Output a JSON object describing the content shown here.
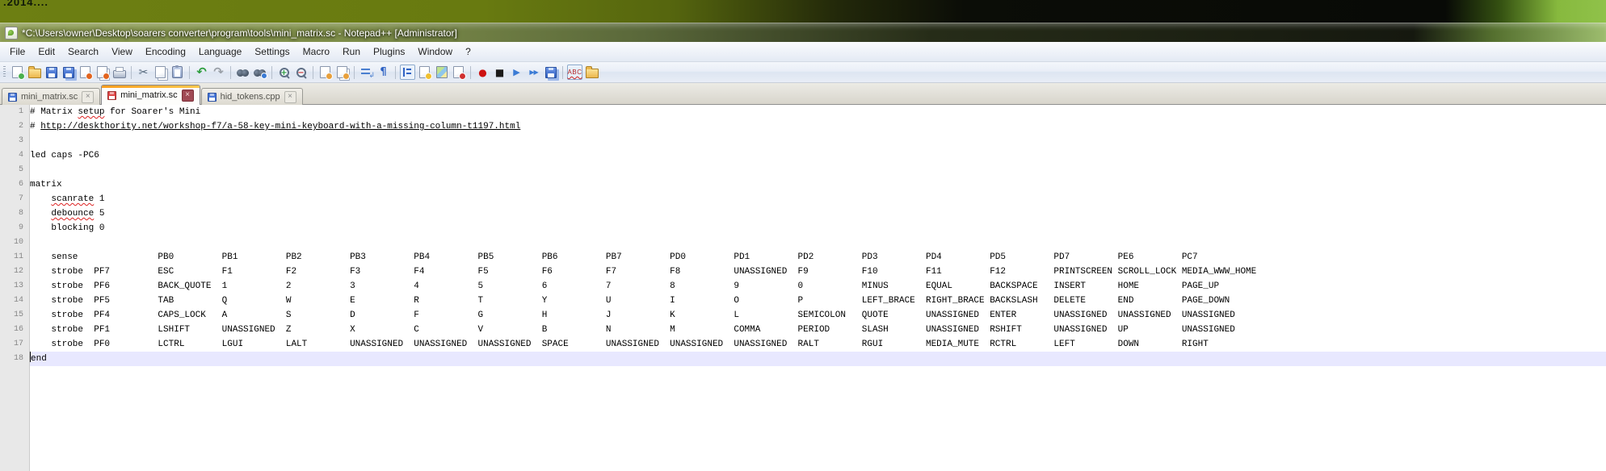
{
  "desktop": {
    "corner_text": ".2014...."
  },
  "window": {
    "title": "*C:\\Users\\owner\\Desktop\\soarers converter\\program\\tools\\mini_matrix.sc - Notepad++ [Administrator]"
  },
  "menu": {
    "items": [
      "File",
      "Edit",
      "Search",
      "View",
      "Encoding",
      "Language",
      "Settings",
      "Macro",
      "Run",
      "Plugins",
      "Window",
      "?"
    ]
  },
  "toolbar": {
    "groups": [
      [
        {
          "name": "new-file",
          "kind": "doc",
          "accent": "#49b04f"
        },
        {
          "name": "open-file",
          "kind": "folder"
        },
        {
          "name": "save-file",
          "kind": "floppy"
        },
        {
          "name": "save-all",
          "kind": "floppy",
          "double": true
        },
        {
          "name": "close-file",
          "kind": "doc",
          "accent": "#e2641f"
        },
        {
          "name": "close-all",
          "kind": "doc",
          "accent": "#e2641f",
          "double": true
        },
        {
          "name": "print",
          "kind": "print"
        }
      ],
      [
        {
          "name": "cut",
          "kind": "glyph",
          "glyph": "✂",
          "color": "#54687c",
          "size": 14
        },
        {
          "name": "copy",
          "kind": "doc",
          "double": true
        },
        {
          "name": "paste",
          "kind": "clip"
        }
      ],
      [
        {
          "name": "undo",
          "kind": "glyph",
          "glyph": "↶",
          "color": "#2e9e3e",
          "size": 15,
          "bold": true
        },
        {
          "name": "redo",
          "kind": "glyph",
          "glyph": "↷",
          "color": "#9aa0a8",
          "size": 15,
          "bold": true
        }
      ],
      [
        {
          "name": "find",
          "kind": "binoc"
        },
        {
          "name": "replace",
          "kind": "binoc",
          "accent": "#3a7bd5"
        }
      ],
      [
        {
          "name": "zoom-in",
          "kind": "mag",
          "accent": "#2e9e3e",
          "sign": "+"
        },
        {
          "name": "zoom-out",
          "kind": "mag",
          "accent": "#cc3333",
          "sign": "−"
        }
      ],
      [
        {
          "name": "sync-scroll-vertical",
          "kind": "doc",
          "accent": "#e8a03c"
        },
        {
          "name": "sync-scroll-horizontal",
          "kind": "doc",
          "accent": "#e8a03c",
          "double": true
        }
      ],
      [
        {
          "name": "word-wrap",
          "kind": "lines",
          "variant": "wrap",
          "color": "#4a7fd0"
        },
        {
          "name": "show-all-characters",
          "kind": "glyph",
          "glyph": "¶",
          "color": "#2f63c4",
          "size": 13,
          "bold": true
        }
      ],
      [
        {
          "name": "indent-guide",
          "kind": "lines",
          "variant": "vert",
          "color": "#2f63c4",
          "pressed": true
        },
        {
          "name": "define-your-language",
          "kind": "doc",
          "accent": "#f0c030"
        },
        {
          "name": "document-map",
          "kind": "map"
        },
        {
          "name": "function-list",
          "kind": "doc",
          "accent": "#d03030"
        }
      ],
      [
        {
          "name": "macro-record",
          "kind": "glyph",
          "glyph": "●",
          "color": "#cc1111",
          "size": 12
        },
        {
          "name": "macro-stop",
          "kind": "glyph",
          "glyph": "■",
          "color": "#1a1a1a",
          "size": 12
        },
        {
          "name": "macro-play",
          "kind": "glyph",
          "glyph": "▶",
          "color": "#3a7bd5",
          "size": 11
        },
        {
          "name": "macro-run-multiple",
          "kind": "glyph",
          "glyph": "▶▶",
          "color": "#3a7bd5",
          "size": 8,
          "bold": true
        },
        {
          "name": "macro-save",
          "kind": "floppy",
          "double": true
        }
      ],
      [
        {
          "name": "spell-check",
          "kind": "abc",
          "label": "ABC",
          "pressed": true
        },
        {
          "name": "file-browser",
          "kind": "folder"
        }
      ]
    ]
  },
  "tabs": [
    {
      "label": "mini_matrix.sc",
      "active": false,
      "modified": false
    },
    {
      "label": "mini_matrix.sc",
      "active": true,
      "modified": true
    },
    {
      "label": "hid_tokens.cpp",
      "active": false,
      "modified": false
    }
  ],
  "editor": {
    "lines": [
      {
        "num": 1,
        "text": "# Matrix setup for Soarer's Mini",
        "misspelled": [
          "setup"
        ]
      },
      {
        "num": 2,
        "text": "# http://deskthority.net/workshop-f7/a-58-key-mini-keyboard-with-a-missing-column-t1197.html",
        "link": "http://deskthority.net/workshop-f7/a-58-key-mini-keyboard-with-a-missing-column-t1197.html"
      },
      {
        "num": 3,
        "text": ""
      },
      {
        "num": 4,
        "text": "led caps -PC6"
      },
      {
        "num": 5,
        "text": ""
      },
      {
        "num": 6,
        "text": "matrix"
      },
      {
        "num": 7,
        "text": "    scanrate 1",
        "misspelled": [
          "scanrate"
        ]
      },
      {
        "num": 8,
        "text": "    debounce 5",
        "misspelled": [
          "debounce"
        ]
      },
      {
        "num": 9,
        "text": "    blocking 0"
      },
      {
        "num": 10,
        "text": ""
      },
      {
        "num": 11,
        "text": "    sense               PB0         PB1         PB2         PB3         PB4         PB5         PB6         PB7         PD0         PD1         PD2         PD3         PD4         PD5         PD7         PE6         PC7"
      },
      {
        "num": 12,
        "text": "    strobe  PF7         ESC         F1          F2          F3          F4          F5          F6          F7          F8          UNASSIGNED  F9          F10         F11         F12         PRINTSCREEN SCROLL_LOCK MEDIA_WWW_HOME"
      },
      {
        "num": 13,
        "text": "    strobe  PF6         BACK_QUOTE  1           2           3           4           5           6           7           8           9           0           MINUS       EQUAL       BACKSPACE   INSERT      HOME        PAGE_UP"
      },
      {
        "num": 14,
        "text": "    strobe  PF5         TAB         Q           W           E           R           T           Y           U           I           O           P           LEFT_BRACE  RIGHT_BRACE BACKSLASH   DELETE      END         PAGE_DOWN"
      },
      {
        "num": 15,
        "text": "    strobe  PF4         CAPS_LOCK   A           S           D           F           G           H           J           K           L           SEMICOLON   QUOTE       UNASSIGNED  ENTER       UNASSIGNED  UNASSIGNED  UNASSIGNED"
      },
      {
        "num": 16,
        "text": "    strobe  PF1         LSHIFT      UNASSIGNED  Z           X           C           V           B           N           M           COMMA       PERIOD      SLASH       UNASSIGNED  RSHIFT      UNASSIGNED  UP          UNASSIGNED"
      },
      {
        "num": 17,
        "text": "    strobe  PF0         LCTRL       LGUI        LALT        UNASSIGNED  UNASSIGNED  UNASSIGNED  SPACE       UNASSIGNED  UNASSIGNED  UNASSIGNED  RALT        RGUI        MEDIA_MUTE  RCTRL       LEFT        DOWN        RIGHT"
      },
      {
        "num": 18,
        "text": "end",
        "current": true,
        "caret": true
      }
    ]
  },
  "colors": {
    "current_line": "#e8e8ff",
    "squiggle": "#cc2222",
    "active_tab_accent": "#ff9d1c",
    "desktop_green": "#6d7f12"
  }
}
